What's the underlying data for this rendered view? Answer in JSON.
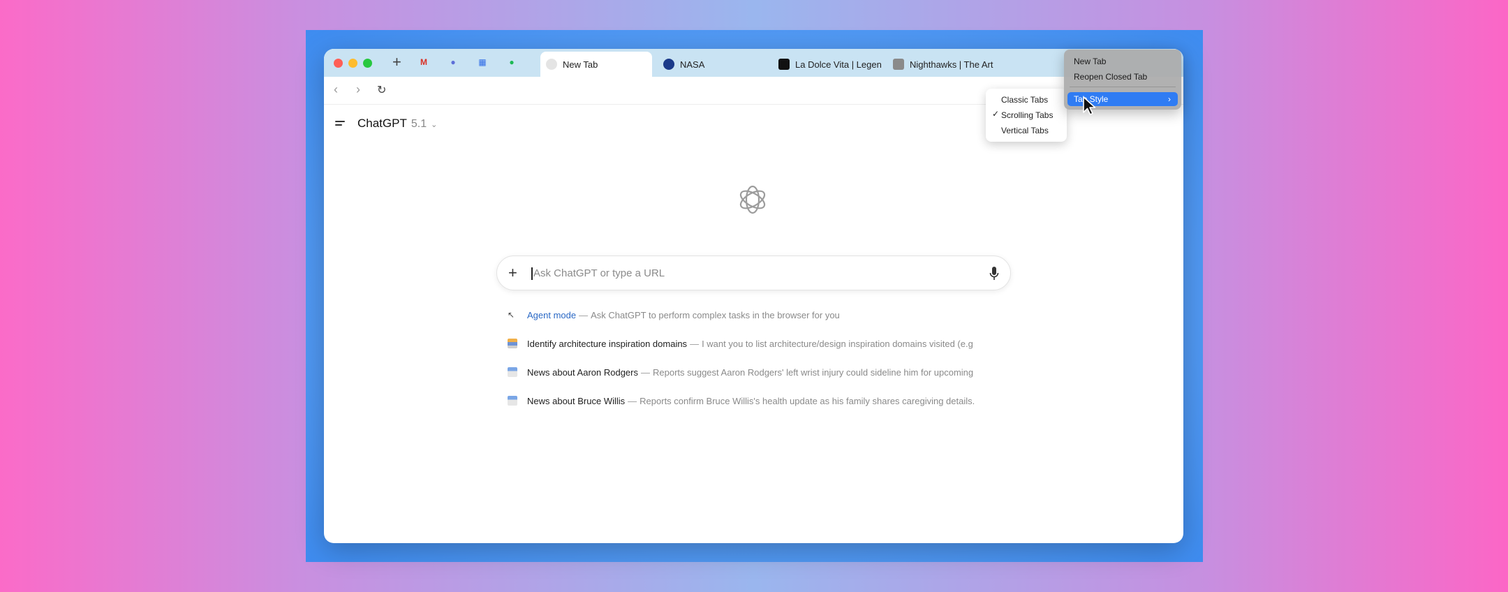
{
  "tabbar": {
    "pinned": [
      {
        "name": "gmail-icon",
        "glyph": "M",
        "color": "#d93025"
      },
      {
        "name": "perplexity-icon",
        "glyph": "●",
        "color": "#5d6fd8"
      },
      {
        "name": "calendar-icon",
        "glyph": "▦",
        "color": "#2e6be6"
      },
      {
        "name": "spotify-icon",
        "glyph": "●",
        "color": "#1db954"
      }
    ],
    "tabs": [
      {
        "label": "New Tab"
      },
      {
        "label": "NASA"
      },
      {
        "label": "La Dolce Vita | Legen"
      },
      {
        "label": "Nighthawks | The Art"
      }
    ]
  },
  "header": {
    "title": "ChatGPT",
    "version": "5.1"
  },
  "search": {
    "placeholder": "Ask ChatGPT or type a URL"
  },
  "suggestions": [
    {
      "title": "Agent mode",
      "desc": "Ask ChatGPT to perform complex tasks in the browser for you"
    },
    {
      "title": "Identify architecture inspiration domains",
      "desc": "I want you to list architecture/design inspiration domains visited (e.g"
    },
    {
      "title": "News about Aaron Rodgers",
      "desc": "Reports suggest Aaron Rodgers' left wrist injury could sideline him for upcoming"
    },
    {
      "title": "News about Bruce Willis",
      "desc": "Reports confirm Bruce Willis's health update as his family shares caregiving details."
    }
  ],
  "context_menu": {
    "items": [
      "New Tab",
      "Reopen Closed Tab",
      "Tab Style"
    ]
  },
  "submenu": {
    "items": [
      "Classic Tabs",
      "Scrolling Tabs",
      "Vertical Tabs"
    ],
    "checked": "✓"
  },
  "colors": {
    "accent": "#2f7cf3",
    "link": "#2a68c5"
  }
}
